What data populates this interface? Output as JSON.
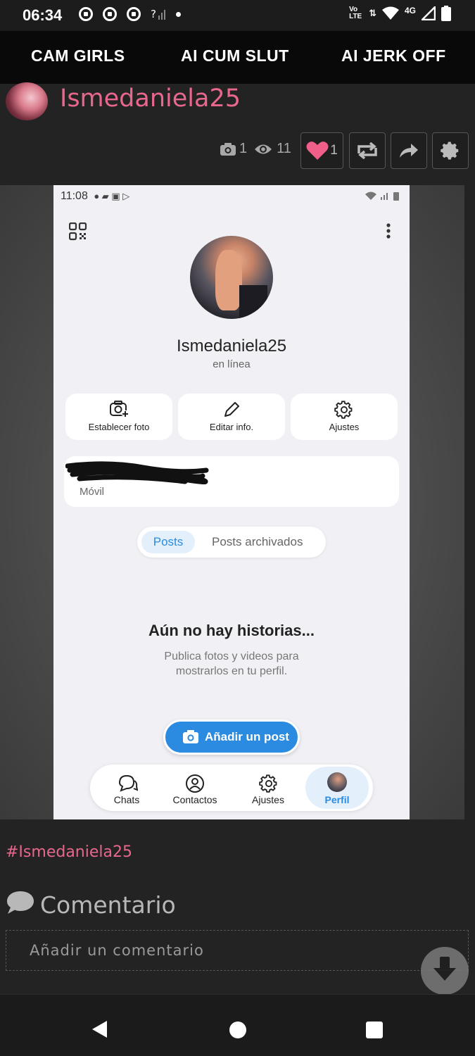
{
  "status_bar": {
    "time": "06:34",
    "network": "4G",
    "volte": "Vo LTE"
  },
  "top_nav": {
    "items": [
      "CAM GIRLS",
      "AI CUM SLUT",
      "AI JERK OFF"
    ]
  },
  "post": {
    "username": "Ismedaniela25",
    "photo_count": "1",
    "view_count": "11",
    "like_count": "1",
    "hashtag": "#Ismedaniela25"
  },
  "screenshot": {
    "time": "11:08",
    "profile_name": "Ismedaniela25",
    "status": "en línea",
    "actions": [
      "Establecer foto",
      "Editar info.",
      "Ajustes"
    ],
    "phone_label": "Móvil",
    "tabs": [
      "Posts",
      "Posts archivados"
    ],
    "empty_title": "Aún no hay historias...",
    "empty_desc_line1": "Publica fotos y videos para",
    "empty_desc_line2": "mostrarlos en tu perfil.",
    "add_post_label": "Añadir un post",
    "bottom_nav": [
      "Chats",
      "Contactos",
      "Ajustes",
      "Perfil"
    ],
    "accent": "#2a8be0"
  },
  "comments": {
    "title": "Comentario",
    "placeholder": "Añadir un comentario"
  },
  "colors": {
    "brand_pink": "#e8678c",
    "like_pink": "#ef5f8a"
  }
}
